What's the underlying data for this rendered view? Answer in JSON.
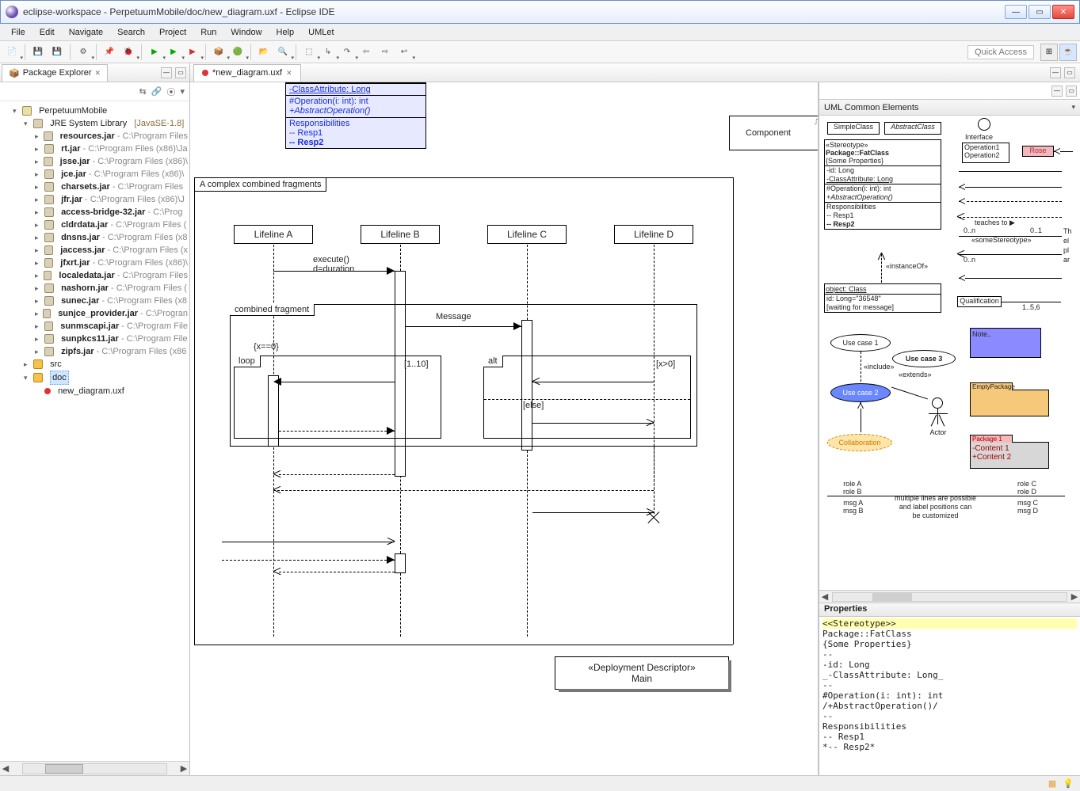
{
  "window": {
    "title": "eclipse-workspace - PerpetuumMobile/doc/new_diagram.uxf - Eclipse IDE"
  },
  "menu": [
    "File",
    "Edit",
    "Navigate",
    "Search",
    "Project",
    "Run",
    "Window",
    "Help",
    "UMLet"
  ],
  "quickAccess": "Quick Access",
  "packageExplorer": {
    "title": "Package Explorer",
    "project": "PerpetuumMobile",
    "jre": {
      "label": "JRE System Library",
      "profile": "[JavaSE-1.8]"
    },
    "jars": [
      {
        "name": "resources.jar",
        "path": "C:\\Program Files"
      },
      {
        "name": "rt.jar",
        "path": "C:\\Program Files (x86)\\Ja"
      },
      {
        "name": "jsse.jar",
        "path": "C:\\Program Files (x86)\\"
      },
      {
        "name": "jce.jar",
        "path": "C:\\Program Files (x86)\\"
      },
      {
        "name": "charsets.jar",
        "path": "C:\\Program Files"
      },
      {
        "name": "jfr.jar",
        "path": "C:\\Program Files (x86)\\J"
      },
      {
        "name": "access-bridge-32.jar",
        "path": "C:\\Prog"
      },
      {
        "name": "cldrdata.jar",
        "path": "C:\\Program Files ("
      },
      {
        "name": "dnsns.jar",
        "path": "C:\\Program Files (x8"
      },
      {
        "name": "jaccess.jar",
        "path": "C:\\Program Files (x"
      },
      {
        "name": "jfxrt.jar",
        "path": "C:\\Program Files (x86)\\"
      },
      {
        "name": "localedata.jar",
        "path": "C:\\Program Files"
      },
      {
        "name": "nashorn.jar",
        "path": "C:\\Program Files ("
      },
      {
        "name": "sunec.jar",
        "path": "C:\\Program Files (x8"
      },
      {
        "name": "sunjce_provider.jar",
        "path": "C:\\Progran"
      },
      {
        "name": "sunmscapi.jar",
        "path": "C:\\Program File"
      },
      {
        "name": "sunpkcs11.jar",
        "path": "C:\\Program File"
      },
      {
        "name": "zipfs.jar",
        "path": "C:\\Program Files (x86"
      }
    ],
    "src": "src",
    "doc": "doc",
    "docFile": "new_diagram.uxf"
  },
  "editor": {
    "tab": "*new_diagram.uxf",
    "fatclass": {
      "attr": "-ClassAttribute: Long",
      "op1": "#Operation(i: int): int",
      "op2": "+AbstractOperation()",
      "respHdr": "Responsibilities",
      "resp1": "-- Resp1",
      "resp2": "-- Resp2"
    },
    "component": "Component",
    "fragTitle": "A complex combined fragments",
    "lifelines": {
      "a": "Lifeline A",
      "b": "Lifeline B",
      "c": "Lifeline C",
      "d": "Lifeline D"
    },
    "msgs": {
      "execute": "execute()",
      "duration": "d=duration",
      "combined": "combined fragment",
      "message": "Message",
      "xeq0": "{x==0}",
      "loop": "loop",
      "range": "[1..10]",
      "alt": "alt",
      "xgt0": "[x>0]",
      "else": "[else]"
    },
    "deploy": {
      "stereo": "«Deployment Descriptor»",
      "name": "Main"
    }
  },
  "palette": {
    "title": "UML Common Elements",
    "simpleClass": "SimpleClass",
    "abstractClass": "AbstractClass",
    "interface": "Interface",
    "op1": "Operation1",
    "op2": "Operation2",
    "rose": "Rose",
    "fat": {
      "stereo": "«Stereotype»",
      "pkg": "Package::FatClass",
      "props": "{Some Properties}",
      "id": "-id: Long",
      "classAttr": "-ClassAttribute: Long",
      "opint": "#Operation(i: int): int",
      "absop": "+AbstractOperation()",
      "respHdr": "Responsibilities",
      "resp1": "-- Resp1",
      "resp2": "-- Resp2"
    },
    "instanceOf": "«instanceOf»",
    "object": {
      "head": "object: Class",
      "id": "id: Long=\"36548\"",
      "wait": "[waiting for message]"
    },
    "teaches": "teaches to ▶",
    "mult": {
      "a": "0..n",
      "b": "0..1",
      "c": "0..n",
      "d": "1..5,6"
    },
    "someStereo": "«someStereotype»",
    "qualification": "Qualification",
    "truncated": "Th\nel\npl\nar",
    "uc1": "Use case 1",
    "uc2": "Use case 2",
    "uc3": "Use case 3",
    "include": "«include»",
    "extends": "«extends»",
    "collab": "Collaboration",
    "actor": "Actor",
    "noteLbl": "Note..",
    "emptyPkg": "EmptyPackage",
    "pkg1": "Package 1",
    "content1": "-Content 1",
    "content2": "+Content 2",
    "roles": {
      "a": "role A",
      "b": "role B",
      "c": "role C",
      "d": "role D"
    },
    "msgs": {
      "a": "msg A",
      "b": "msg B",
      "c": "msg C",
      "d": "msg D"
    },
    "lines": [
      "multiple lines are possible",
      "and label positions can",
      "be customized"
    ]
  },
  "properties": {
    "title": "Properties",
    "lines": [
      "<<Stereotype>>",
      "Package::FatClass",
      "{Some Properties}",
      "--",
      "-id: Long",
      "_-ClassAttribute: Long_",
      "--",
      "#Operation(i: int): int",
      "/+AbstractOperation()/",
      "--",
      "Responsibilities",
      "-- Resp1",
      "*-- Resp2*"
    ]
  }
}
